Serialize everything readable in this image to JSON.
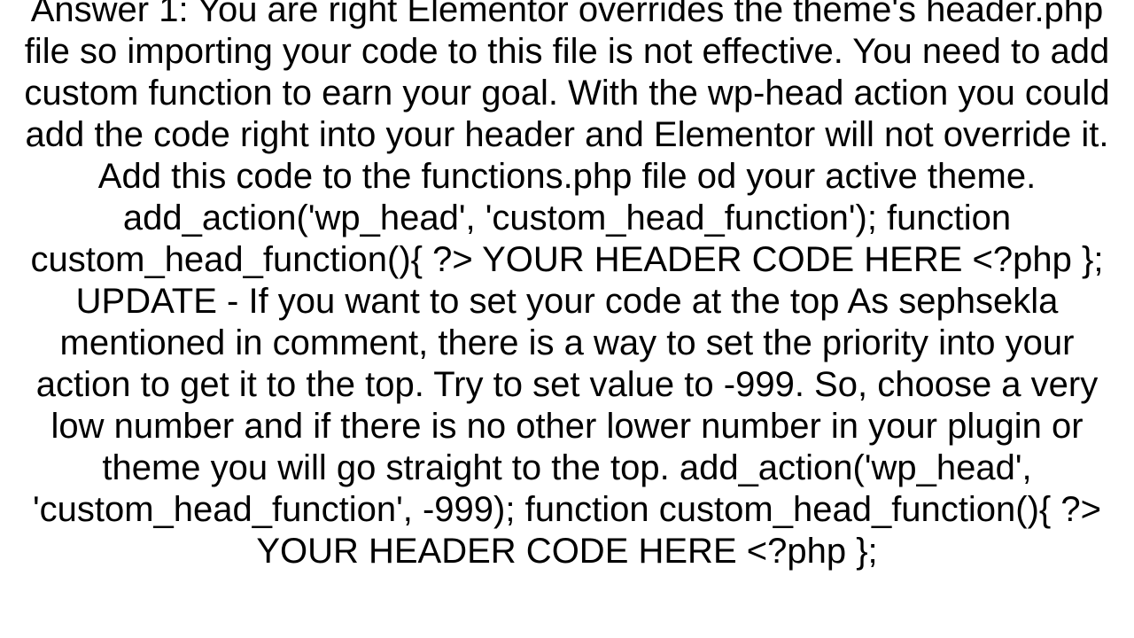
{
  "page": {
    "background_color": "#ffffff",
    "text_color": "#000000",
    "alignment": "center"
  },
  "answer": {
    "full_text": "Answer 1: You are right Elementor overrides the theme's header.php file so importing your code to this file is not effective. You need to add custom function to earn your goal. With the wp-head action you could add the code right into your header and Elementor will not override it. Add this code to the functions.php file od your active theme. add_action('wp_head', 'custom_head_function'); function custom_head_function(){ ?> YOUR HEADER CODE HERE <?php }; UPDATE - If you want to set your code at the top As sephsekla mentioned in comment, there is a way to set the priority into your action to get it to the top. Try to set value to -999. So, choose a very low number and if there is no other lower number in your plugin or theme you will go straight to the top. add_action('wp_head', 'custom_head_function', -999); function custom_head_function(){ ?> YOUR HEADER CODE HERE <?php };",
    "lines": [
      "Answer 1: You are right Elementor overrides the theme's",
      "header.php file so importing your code to this file is not",
      "effective. You need to add custom function to earn your",
      "goal. With the wp-head action you could add the code right",
      "into your header and Elementor will not override it. Add",
      "this code to the functions.php file od your active theme.",
      "add_action('wp_head', 'custom_head_function'); function",
      "custom_head_function(){ ?> YOUR HEADER CODE HERE <?php };",
      "UPDATE - If you want to set your code at the top As",
      "sephsekla mentioned in comment, there is a way to set the",
      "priority into your action to get it to the top. Try to set",
      "value to -999. So, choose a very low number and if there is",
      "no other lower number in your plugin or theme you will go",
      "straight to the top. add_action('wp_head',",
      "'custom_head_function', -999); function",
      "custom_head_function(){ ?> YOUR HEADER CODE HERE <?php };"
    ],
    "label": "Answer 1"
  }
}
